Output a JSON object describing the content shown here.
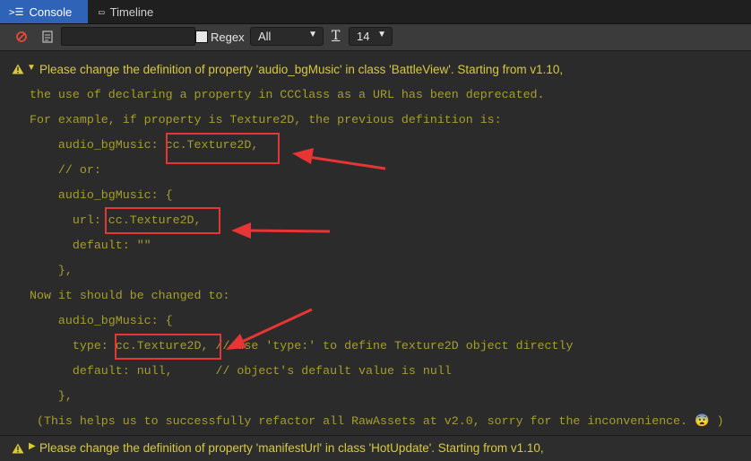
{
  "tabs": [
    {
      "label": "Console",
      "icon": "console-icon"
    },
    {
      "label": "Timeline",
      "icon": "timeline-icon"
    }
  ],
  "toolbar": {
    "clear_icon": "clear-icon",
    "file_icon": "file-icon",
    "search_value": "",
    "regex_label": "Regex",
    "level_value": "All",
    "font_icon_glyph": "T",
    "font_size_value": "14"
  },
  "log": {
    "header": "Please change the definition of property 'audio_bgMusic' in class 'BattleView'. Starting from v1.10,",
    "lines": [
      "the use of declaring a property in CCClass as a URL has been deprecated.",
      "For example, if property is Texture2D, the previous definition is:",
      "    audio_bgMusic: cc.Texture2D,",
      "    // or:",
      "    audio_bgMusic: {",
      "      url: cc.Texture2D,",
      "      default: \"\"",
      "    },",
      "Now it should be changed to:",
      "    audio_bgMusic: {",
      "      type: cc.Texture2D, // use 'type:' to define Texture2D object directly",
      "      default: null,      // object's default value is null",
      "    },",
      " (This helps us to successfully refactor all RawAssets at v2.0, sorry for the inconvenience. 😨 )"
    ]
  },
  "log2": {
    "header": "Please change the definition of property 'manifestUrl' in class 'HotUpdate'. Starting from v1.10,"
  },
  "colors": {
    "warning": "#d7c93b",
    "body_text": "#a69e2c",
    "highlight": "#e53535",
    "tab_active": "#2f63b8"
  }
}
